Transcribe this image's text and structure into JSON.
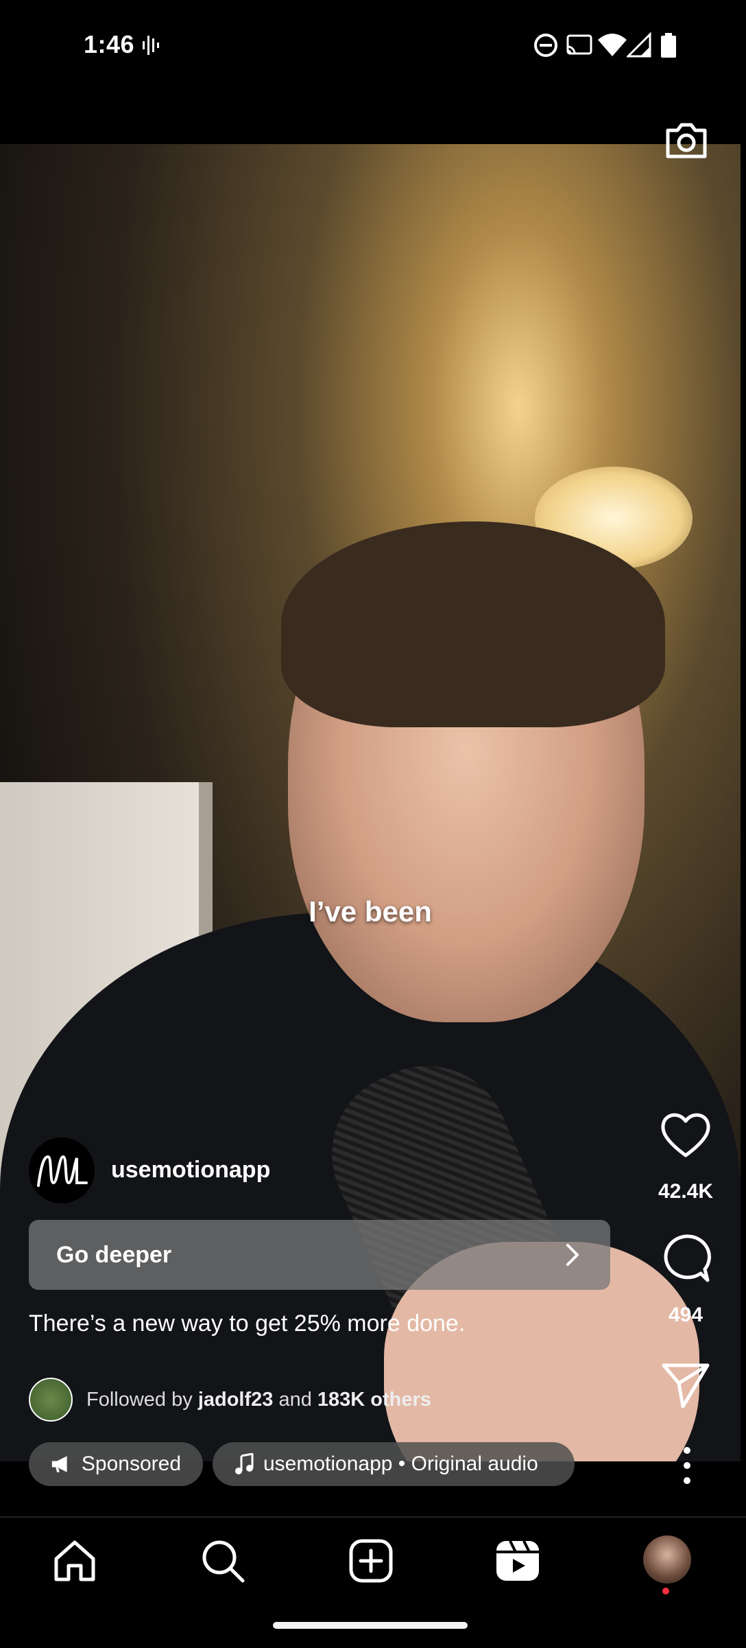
{
  "status_bar": {
    "time": "1:46"
  },
  "video": {
    "caption": "I’ve been"
  },
  "rail": {
    "likes": "42.4K",
    "comments": "494"
  },
  "post": {
    "username": "usemotionapp",
    "cta_label": "Go deeper",
    "caption": "There’s a new way to get 25% more done.",
    "followed_prefix": "Followed by",
    "followed_user": "jadolf23",
    "followed_and": "and",
    "followed_others": "183K others",
    "sponsored": "Sponsored",
    "audio": "usemotionapp • Original audio"
  }
}
